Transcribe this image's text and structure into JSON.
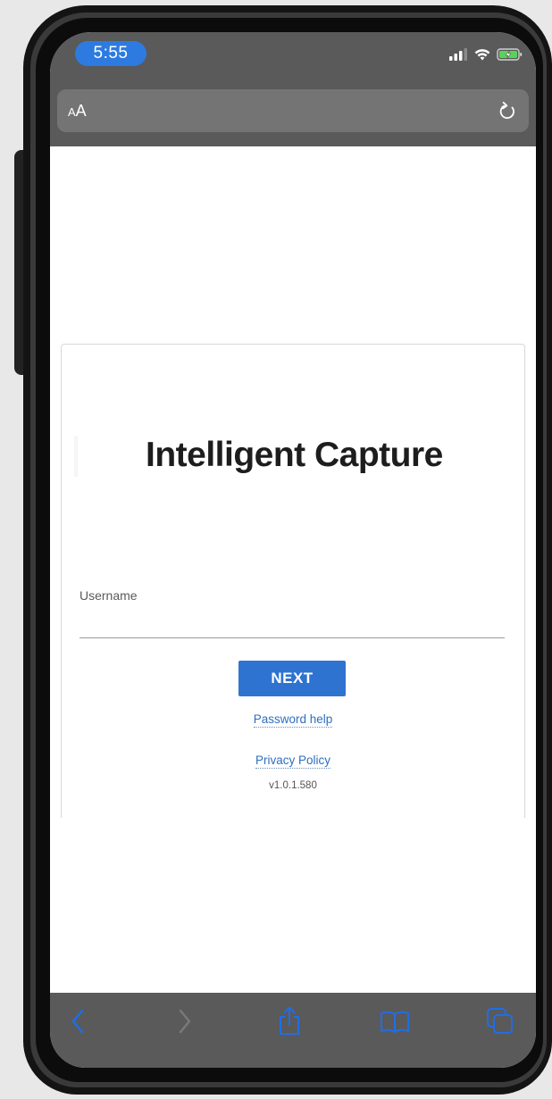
{
  "status_bar": {
    "time": "5:55"
  },
  "browser": {
    "address_bar_text_small": "A",
    "address_bar_text_large": "A"
  },
  "login": {
    "app_title": "Intelligent Capture",
    "username_label": "Username",
    "username_value": "",
    "next_button": "NEXT",
    "password_help_link": "Password help",
    "privacy_policy_link": "Privacy Policy",
    "version": "v1.0.1.580"
  },
  "toolbar": {
    "icons": [
      "back-icon",
      "forward-icon",
      "share-icon",
      "bookmarks-icon",
      "tabs-icon"
    ]
  },
  "colors": {
    "time_pill": "#2d7be0",
    "primary_button": "#2f73d1",
    "link": "#2d6fbf",
    "toolbar_icons": "#1e6ee8",
    "battery_charging": "#5ad15a",
    "chrome_background": "#5a5a5a"
  }
}
